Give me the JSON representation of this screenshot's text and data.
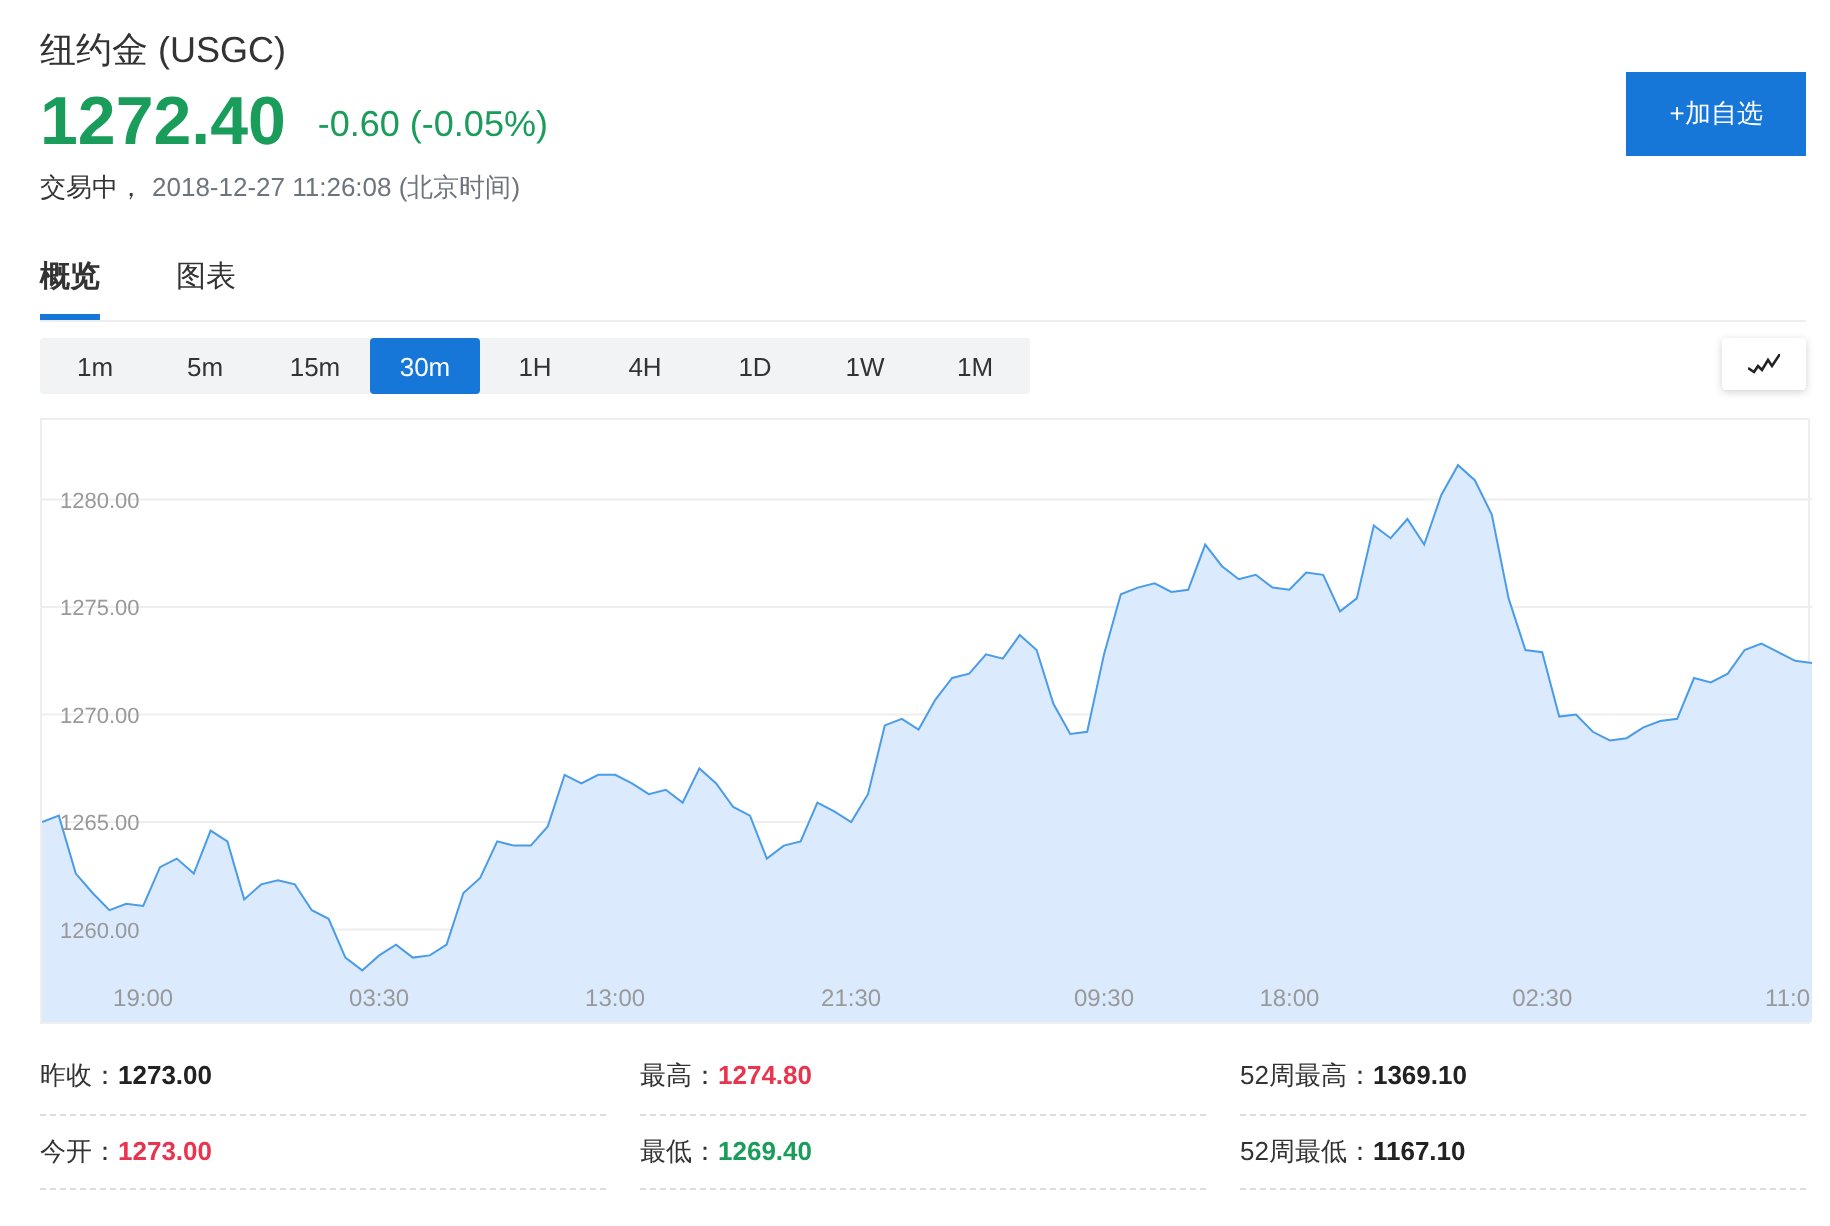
{
  "header": {
    "name": "纽约金",
    "code": "(USGC)",
    "price": "1272.40",
    "change": "-0.60 (-0.05%)",
    "color": "#1a9d5b",
    "status": "交易中，",
    "time": "2018-12-27 11:26:08",
    "timezone": "(北京时间)",
    "watch_button": "+加自选"
  },
  "tabs": [
    {
      "label": "概览",
      "selected": true
    },
    {
      "label": "图表",
      "selected": false
    }
  ],
  "periods": [
    {
      "label": "1m",
      "selected": false
    },
    {
      "label": "5m",
      "selected": false
    },
    {
      "label": "15m",
      "selected": false
    },
    {
      "label": "30m",
      "selected": true
    },
    {
      "label": "1H",
      "selected": false
    },
    {
      "label": "4H",
      "selected": false
    },
    {
      "label": "1D",
      "selected": false
    },
    {
      "label": "1W",
      "selected": false
    },
    {
      "label": "1M",
      "selected": false
    }
  ],
  "chart_data": {
    "type": "area",
    "grid": "y",
    "ylim": [
      1255.7,
      1283.7
    ],
    "categories": [
      null,
      null,
      null,
      null,
      null,
      null,
      "19:00",
      null,
      null,
      null,
      null,
      null,
      null,
      null,
      null,
      null,
      null,
      null,
      null,
      null,
      "03:30",
      null,
      null,
      null,
      null,
      null,
      null,
      null,
      null,
      null,
      null,
      null,
      null,
      null,
      "13:00",
      null,
      null,
      null,
      null,
      null,
      null,
      null,
      null,
      null,
      null,
      null,
      null,
      null,
      "21:30",
      null,
      null,
      null,
      null,
      null,
      null,
      null,
      null,
      null,
      null,
      null,
      null,
      null,
      null,
      "09:30",
      null,
      null,
      null,
      null,
      null,
      null,
      null,
      null,
      null,
      null,
      "18:00",
      null,
      null,
      null,
      null,
      null,
      null,
      null,
      null,
      null,
      null,
      null,
      null,
      null,
      null,
      "02:30",
      null,
      null,
      null,
      null,
      null,
      null,
      null,
      null,
      null,
      null,
      null,
      null,
      null,
      null,
      "11:0",
      null
    ],
    "yticks": [
      {
        "value": 1260,
        "label": "1260.00"
      },
      {
        "value": 1265,
        "label": "1265.00"
      },
      {
        "value": 1270,
        "label": "1270.00"
      },
      {
        "value": 1275,
        "label": "1275.00"
      },
      {
        "value": 1280,
        "label": "1280.00"
      }
    ],
    "series": [
      {
        "color": "#4a9ce8",
        "values": [
          1265.0,
          1265.3,
          1262.6,
          1261.7,
          1260.9,
          1261.2,
          1261.1,
          1262.9,
          1263.3,
          1262.6,
          1264.6,
          1264.1,
          1261.4,
          1262.1,
          1262.3,
          1262.1,
          1260.9,
          1260.5,
          1258.7,
          1258.1,
          1258.8,
          1259.3,
          1258.7,
          1258.8,
          1259.3,
          1261.7,
          1262.4,
          1264.1,
          1263.9,
          1263.9,
          1264.8,
          1267.2,
          1266.8,
          1267.2,
          1267.2,
          1266.8,
          1266.3,
          1266.5,
          1265.9,
          1267.5,
          1266.8,
          1265.7,
          1265.3,
          1263.3,
          1263.9,
          1264.1,
          1265.9,
          1265.5,
          1265.0,
          1266.3,
          1269.5,
          1269.8,
          1269.3,
          1270.7,
          1271.7,
          1271.9,
          1272.8,
          1272.6,
          1273.7,
          1273.0,
          1270.5,
          1269.1,
          1269.2,
          1272.8,
          1275.6,
          1275.9,
          1276.1,
          1275.7,
          1275.8,
          1277.9,
          1276.9,
          1276.3,
          1276.5,
          1275.9,
          1275.8,
          1276.6,
          1276.5,
          1274.8,
          1275.4,
          1278.8,
          1278.2,
          1279.1,
          1277.9,
          1280.2,
          1281.6,
          1280.9,
          1279.3,
          1275.4,
          1273.0,
          1272.9,
          1269.9,
          1270.0,
          1269.2,
          1268.8,
          1268.9,
          1269.4,
          1269.7,
          1269.8,
          1271.7,
          1271.5,
          1271.9,
          1273.0,
          1273.3,
          1272.9,
          1272.5,
          1272.4
        ]
      }
    ]
  },
  "stats": [
    {
      "label": "昨收：",
      "value": "1273.00",
      "color": "#222222"
    },
    {
      "label": "最高：",
      "value": "1274.80",
      "color": "#e8344e"
    },
    {
      "label": "52周最高：",
      "value": "1369.10",
      "color": "#222222"
    },
    {
      "label": "今开：",
      "value": "1273.00",
      "color": "#e8344e"
    },
    {
      "label": "最低：",
      "value": "1269.40",
      "color": "#1a9d5b"
    },
    {
      "label": "52周最低：",
      "value": "1167.10",
      "color": "#222222"
    }
  ]
}
